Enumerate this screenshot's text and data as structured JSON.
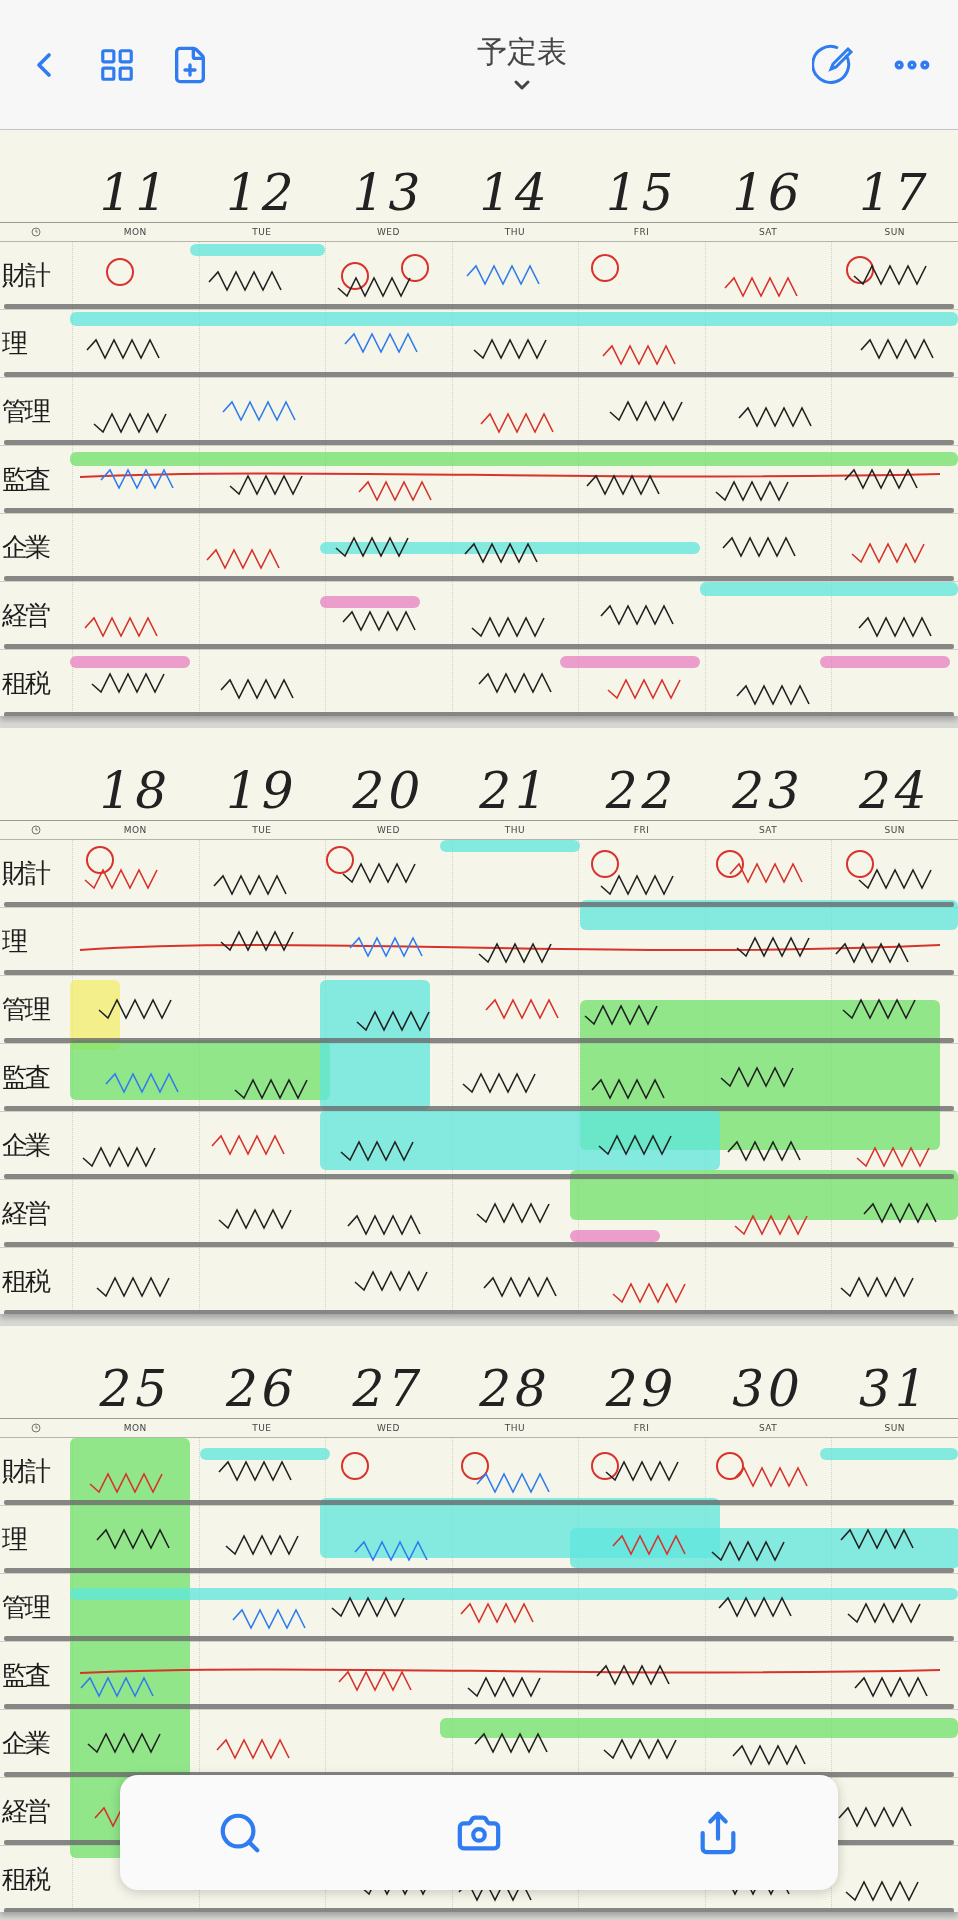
{
  "top_bar": {
    "title": "予定表"
  },
  "weeks": [
    {
      "dates": [
        "11",
        "12",
        "13",
        "14",
        "15",
        "16",
        "17"
      ],
      "days": [
        "MON",
        "TUE",
        "WED",
        "THU",
        "FRI",
        "SAT",
        "SUN"
      ],
      "subjects": [
        "財計",
        "理",
        "管理",
        "監査",
        "企業",
        "経営",
        "租税"
      ]
    },
    {
      "dates": [
        "18",
        "19",
        "20",
        "21",
        "22",
        "23",
        "24"
      ],
      "days": [
        "MON",
        "TUE",
        "WED",
        "THU",
        "FRI",
        "SAT",
        "SUN"
      ],
      "subjects": [
        "財計",
        "理",
        "管理",
        "監査",
        "企業",
        "経営",
        "租税"
      ]
    },
    {
      "dates": [
        "25",
        "26",
        "27",
        "28",
        "29",
        "30",
        "31"
      ],
      "days": [
        "MON",
        "TUE",
        "WED",
        "THU",
        "FRI",
        "SAT",
        "SUN"
      ],
      "subjects": [
        "財計",
        "理",
        "管理",
        "監査",
        "企業",
        "経営",
        "租税"
      ]
    }
  ]
}
